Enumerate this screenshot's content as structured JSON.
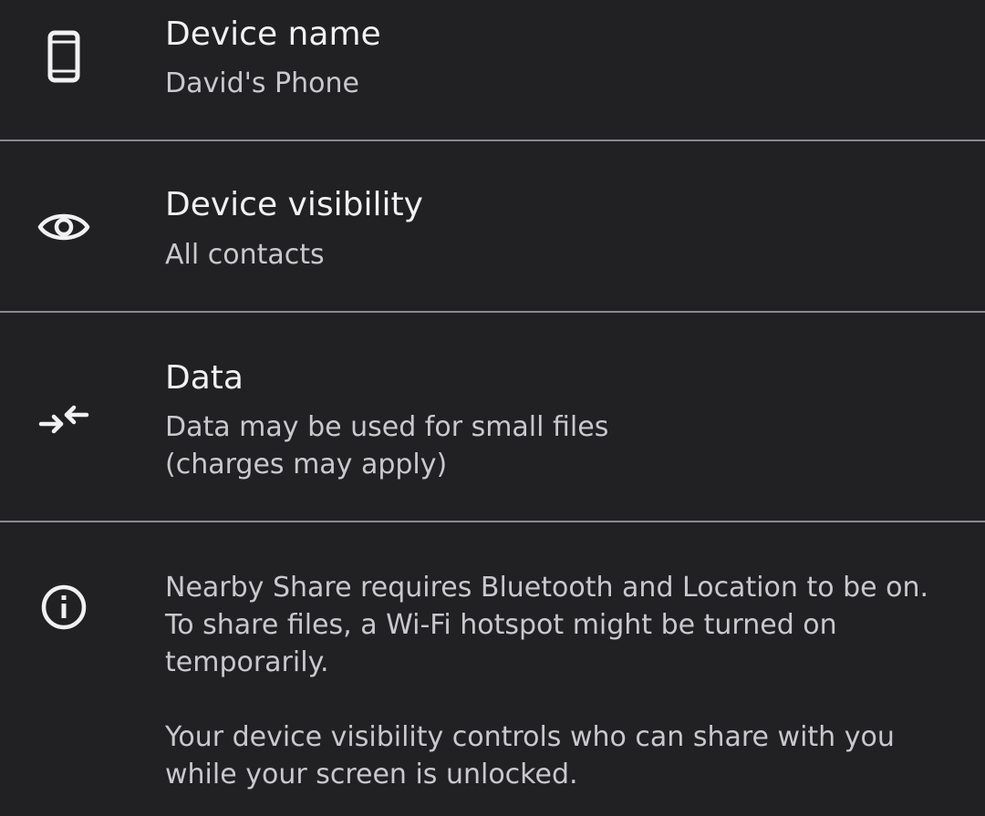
{
  "settings": {
    "device_name": {
      "title": "Device name",
      "value": "David's Phone",
      "icon": "smartphone-icon"
    },
    "device_visibility": {
      "title": "Device visibility",
      "value": "All contacts",
      "icon": "eye-icon"
    },
    "data": {
      "title": "Data",
      "value_line1": "Data may be used for small files",
      "value_line2": "(charges may apply)",
      "icon": "data-transfer-arrows-icon"
    },
    "info": {
      "icon": "info-icon",
      "paragraph1": "Nearby Share requires Bluetooth and Location to be on. To share files, a Wi-Fi hotspot might be turned on temporarily.",
      "paragraph2": "Your device visibility controls who can share with you while your screen is unlocked."
    }
  },
  "colors": {
    "background": "#212124",
    "divider": "#8a8a8e",
    "title_text": "#f1f1f3",
    "secondary_text": "#c9c9cd"
  }
}
